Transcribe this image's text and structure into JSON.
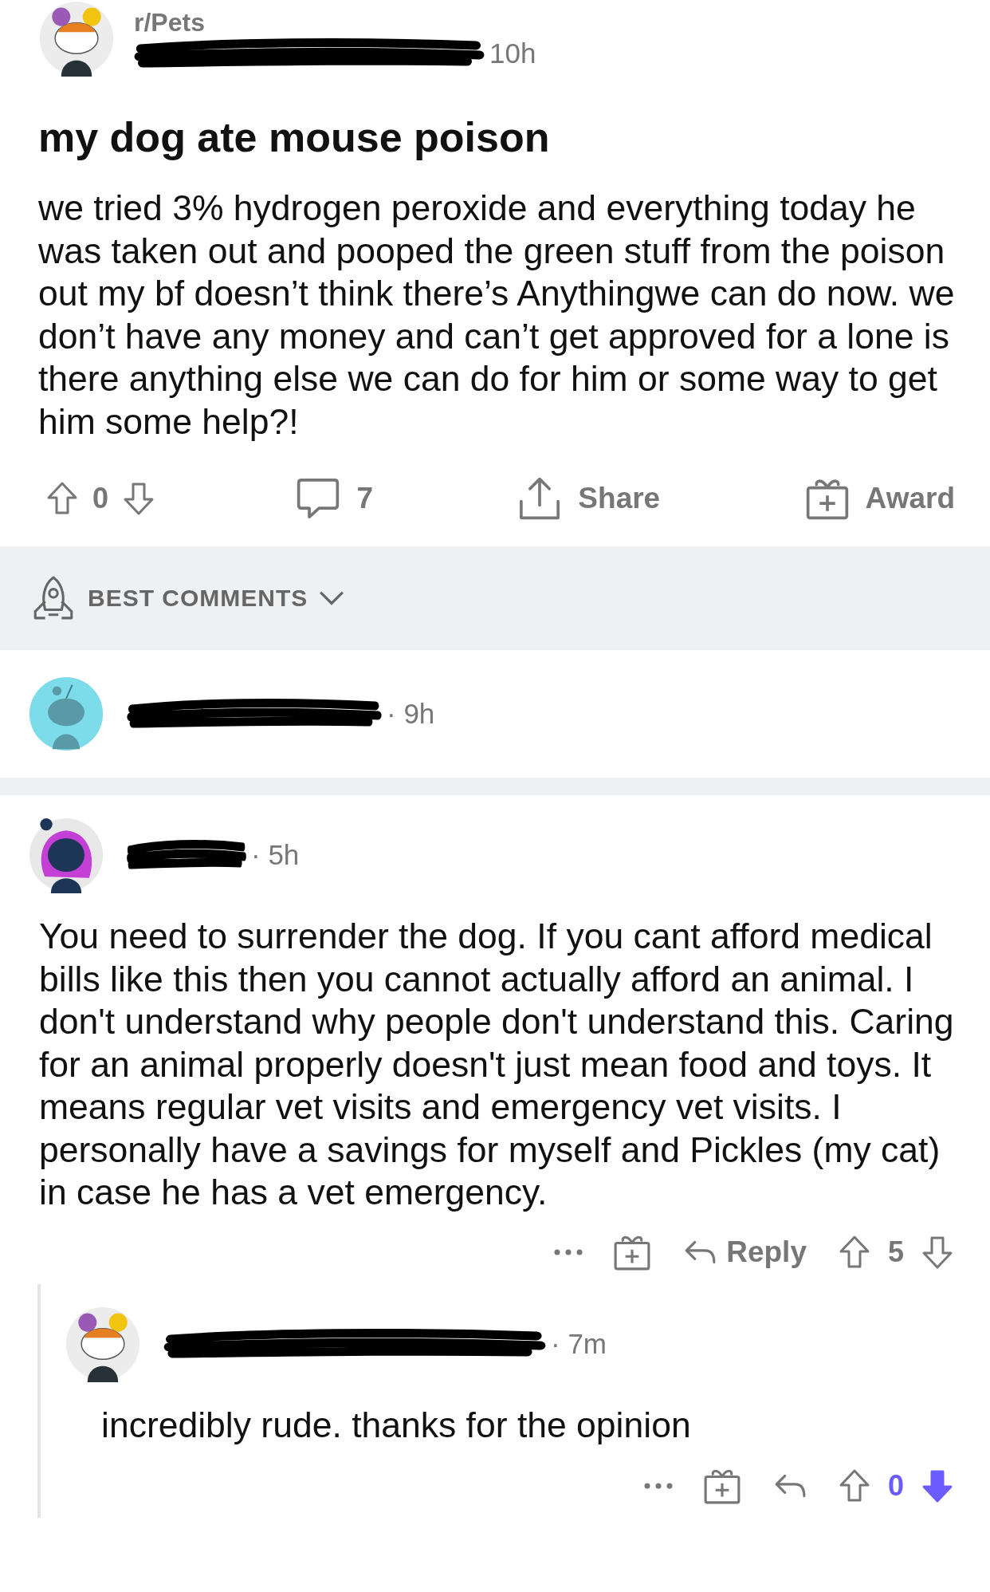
{
  "post": {
    "subreddit": "r/Pets",
    "age": "10h",
    "title": "my dog ate mouse poison",
    "body": "we tried 3% hydrogen peroxide and everything today he was taken out and pooped the green stuff from the poison out my bf doesn’t think there’s Anythingwe can do now. we don’t have any money and can’t get approved for a lone is there anything else we can do for him or some way to get him some help?!",
    "score": "0",
    "upvoted": false,
    "downvoted": false,
    "comments": "7",
    "share": "Share",
    "award": "Award"
  },
  "sort": {
    "label": "BEST COMMENTS"
  },
  "comments": [
    {
      "kind": "plain",
      "age": "· 9h"
    },
    {
      "kind": "hooded",
      "age": "· 5h",
      "body": "You need to surrender the dog. If you cant afford medical bills like this then you cannot actually afford an animal. I don't understand why people don't understand this. Caring for an animal properly doesn't just mean food and toys. It means regular vet visits and emergency vet visits. I personally have a savings for myself and Pickles (my cat) in case he has a vet emergency.",
      "reply": "Reply",
      "score": "5",
      "upvoted": false,
      "downvoted": false,
      "children": [
        {
          "kind": "buns",
          "age": "· 7m",
          "body": "incredibly rude. thanks for the opinion",
          "score": "0",
          "upvoted": false,
          "downvoted": true
        }
      ]
    }
  ]
}
